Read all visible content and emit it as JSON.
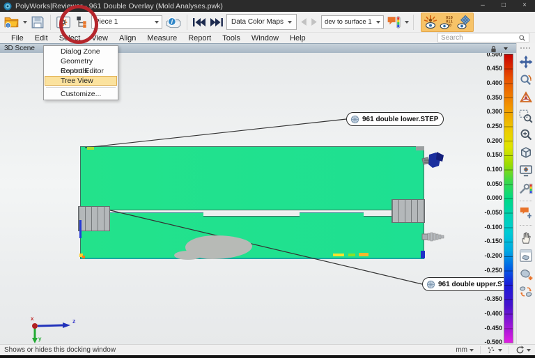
{
  "titlebar": {
    "title": "PolyWorks|Reviewer - 961 Double Overlay (Mold Analyses.pwk)",
    "minimize": "–",
    "maximize": "□",
    "close": "×"
  },
  "toolbar": {
    "piece_combo": "Piece 1",
    "data_color_maps": "Data Color Maps",
    "dev_combo": "dev to surface 1"
  },
  "menubar": {
    "items": [
      "File",
      "Edit",
      "Select",
      "View",
      "Align",
      "Measure",
      "Report",
      "Tools",
      "Window",
      "Help"
    ]
  },
  "search": {
    "placeholder": "Search"
  },
  "scene": {
    "tab": "3D Scene"
  },
  "view_menu": {
    "items": [
      {
        "label": "Dialog Zone"
      },
      {
        "label": "Geometry Controls"
      },
      {
        "label": "Report Editor"
      },
      {
        "label": "Tree View",
        "highlighted": true
      },
      {
        "label": "Customize...",
        "separator_before": true
      }
    ]
  },
  "annotations": {
    "lower_label": "961 double lower.STEP",
    "upper_label": "961 double upper.ST"
  },
  "axes": {
    "x": "x",
    "y": "y",
    "z": "z"
  },
  "color_scale": {
    "ticks": [
      "0.500",
      "0.450",
      "0.400",
      "0.350",
      "0.300",
      "0.250",
      "0.200",
      "0.150",
      "0.100",
      "0.050",
      "0.000",
      "-0.050",
      "-0.100",
      "-0.150",
      "-0.200",
      "-0.250",
      "-0.300",
      "-0.350",
      "-0.400",
      "-0.450",
      "-0.500"
    ],
    "gradient": [
      {
        "pos": 0.0,
        "color": "#c80000"
      },
      {
        "pos": 0.08,
        "color": "#e84d00"
      },
      {
        "pos": 0.18,
        "color": "#f29400"
      },
      {
        "pos": 0.27,
        "color": "#eccf00"
      },
      {
        "pos": 0.32,
        "color": "#dfe400"
      },
      {
        "pos": 0.38,
        "color": "#9fdc00"
      },
      {
        "pos": 0.44,
        "color": "#3cd94a"
      },
      {
        "pos": 0.5,
        "color": "#00da84"
      },
      {
        "pos": 0.56,
        "color": "#00d2b4"
      },
      {
        "pos": 0.62,
        "color": "#00cbd6"
      },
      {
        "pos": 0.68,
        "color": "#00a9e2"
      },
      {
        "pos": 0.74,
        "color": "#0062e6"
      },
      {
        "pos": 0.8,
        "color": "#1a1ad8"
      },
      {
        "pos": 0.87,
        "color": "#4512cd"
      },
      {
        "pos": 0.93,
        "color": "#8c14d4"
      },
      {
        "pos": 1.0,
        "color": "#e21ee2"
      }
    ]
  },
  "right_toolbar": {
    "icons": [
      "drag-handle-icon",
      "pan-icon",
      "orbit-icon",
      "rotate-3d-icon",
      "zoom-region-icon",
      "zoom-cursor-icon",
      "view-cube-icon",
      "display-options-icon",
      "colormap-editor-icon",
      "separator",
      "annotation-move-icon",
      "separator",
      "select-hand-icon",
      "object-window-icon",
      "add-object-icon",
      "compare-objects-icon"
    ]
  },
  "status": {
    "message": "Shows or hides this docking window",
    "units": "mm"
  },
  "colors": {
    "model_green": "#1ee092",
    "highlight_orange": "#f7c368",
    "annotation_ring": "#b5262c"
  }
}
